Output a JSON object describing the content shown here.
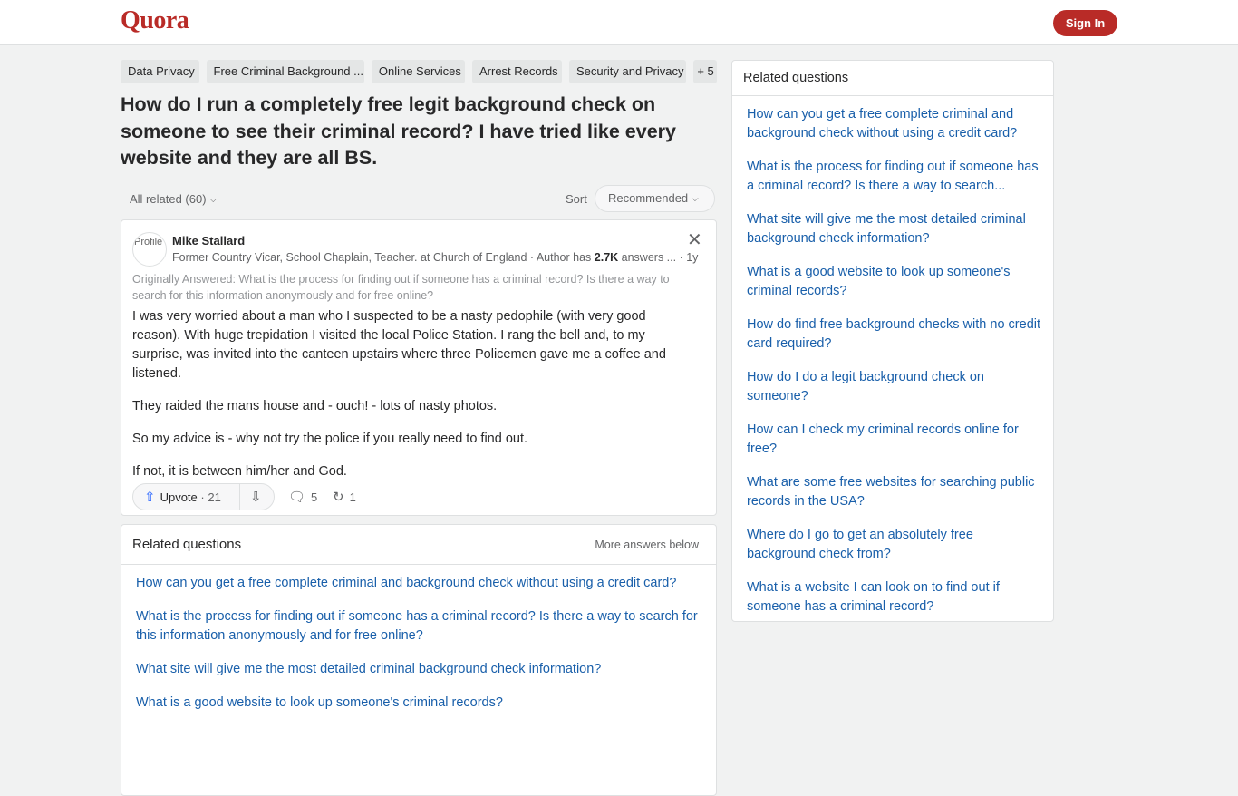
{
  "header": {
    "logo": "Quora",
    "signin_label": "Sign In"
  },
  "tags": [
    "Data Privacy",
    "Free Criminal Background ...",
    "Online Services",
    "Arrest Records",
    "Security and Privacy",
    "+ 5"
  ],
  "question": {
    "title": "How do I run a completely free legit background check on someone to see their criminal record? I have tried like every website and they are all BS."
  },
  "filter": {
    "all_related": "All related (60)",
    "sort_label": "Sort",
    "sort_value": "Recommended"
  },
  "answer": {
    "avatar_alt": "Profile",
    "author": "Mike Stallard",
    "credential_prefix": "Former Country Vicar, School Chaplain, Teacher. at Church of England · Author has ",
    "answer_count": "2.7K",
    "credential_suffix": " answers ...",
    "age": "· 1y",
    "originally_answered": "Originally Answered: What is the process for finding out if someone has a criminal record? Is there a way to search for this information anonymously and for free online?",
    "paragraphs": [
      "I was very worried about a man who I suspected to be a nasty pedophile (with very good reason). With huge trepidation I visited the local Police Station. I rang the bell and, to my surprise, was invited into the canteen upstairs where three Policemen gave me a coffee and listened.",
      "They raided the mans house and - ouch! - lots of nasty photos.",
      "So my advice is - why not try the police if you really need to find out.",
      "If not, it is between him/her and God."
    ],
    "upvote_label": "Upvote",
    "upvote_count": "· 21",
    "comments_count": "5",
    "shares_count": "1"
  },
  "related_inline": {
    "title": "Related questions",
    "more": "More answers below",
    "items": [
      "How can you get a free complete criminal and background check without using a credit card?",
      "What is the process for finding out if someone has a criminal record? Is there a way to search for this information anonymously and for free online?",
      "What site will give me the most detailed criminal background check information?",
      "What is a good website to look up someone's criminal records?"
    ]
  },
  "sidebar": {
    "title": "Related questions",
    "items": [
      "How can you get a free complete criminal and background check without using a credit card?",
      "What is the process for finding out if someone has a criminal record? Is there a way to search...",
      "What site will give me the most detailed criminal background check information?",
      "What is a good website to look up someone's criminal records?",
      "How do find free background checks with no credit card required?",
      "How do I do a legit background check on someone?",
      "How can I check my criminal records online for free?",
      "What are some free websites for searching public records in the USA?",
      "Where do I go to get an absolutely free background check from?",
      "What is a website I can look on to find out if someone has a criminal record?"
    ]
  },
  "colors": {
    "brand": "#b92b27",
    "link": "#195faa",
    "upvote_icon": "#2e69ff"
  },
  "icons": {
    "chevron": "chevron-down-icon",
    "close": "close-icon",
    "upvote": "upvote-arrow-icon",
    "downvote": "downvote-arrow-icon",
    "comment": "comment-icon",
    "share": "share-icon"
  }
}
